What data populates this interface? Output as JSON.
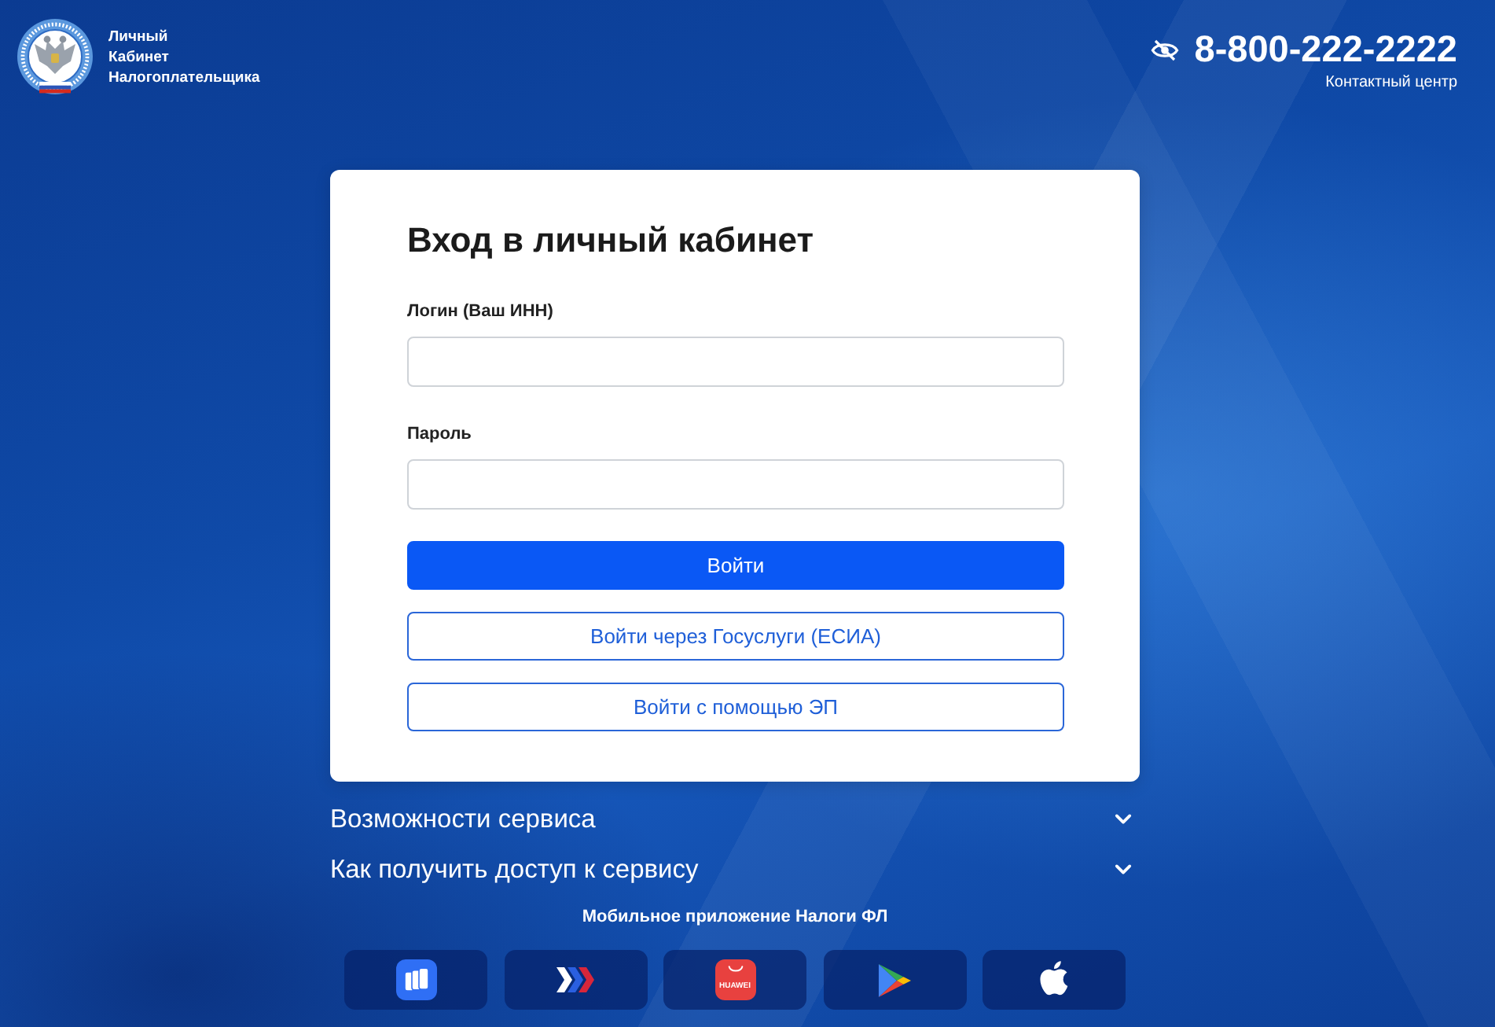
{
  "header": {
    "site_title_lines": [
      "Личный",
      "Кабинет",
      "Налогоплательщика"
    ],
    "phone": "8-800-222-2222",
    "phone_caption": "Контактный центр"
  },
  "login_form": {
    "title": "Вход в личный кабинет",
    "fields": [
      {
        "label": "Логин (Ваш ИНН)"
      },
      {
        "label": "Пароль"
      }
    ],
    "buttons": [
      {
        "label": "Войти",
        "kind": "primary"
      },
      {
        "label": "Войти через Госуслуги (ЕСИА)",
        "kind": "outline"
      },
      {
        "label": "Войти с помощью ЭП",
        "kind": "outline"
      }
    ]
  },
  "accordion": [
    {
      "title": "Возможности сервиса",
      "expanded": false
    },
    {
      "title": "Как получить доступ к сервису",
      "expanded": false
    }
  ],
  "mobile_apps": {
    "title": "Мобильное приложение Налоги ФЛ",
    "stores": [
      {
        "kind": "blocks"
      },
      {
        "kind": "chevrons"
      },
      {
        "kind": "bag",
        "label": "HUAWEI"
      },
      {
        "kind": "play"
      },
      {
        "kind": "apple"
      }
    ]
  }
}
